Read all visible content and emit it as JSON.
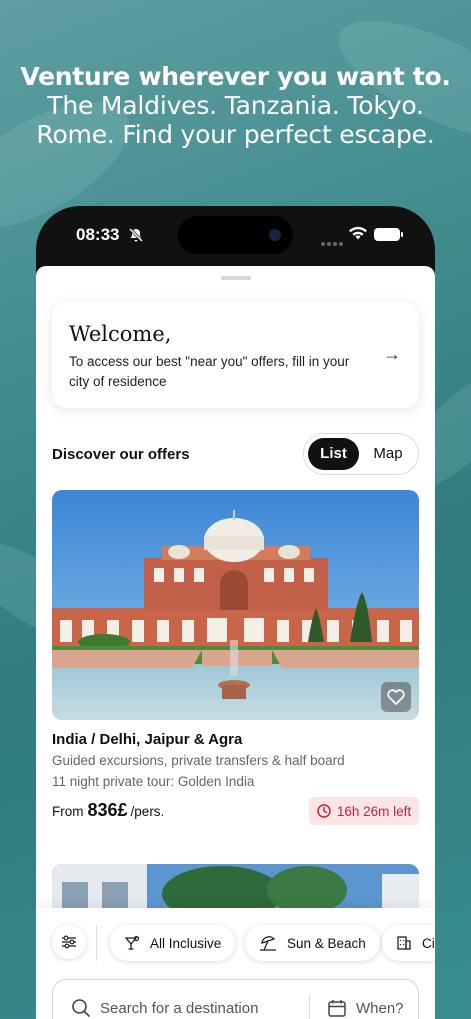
{
  "headline": {
    "line1": "Venture wherever you want to.",
    "line2": "The Maldives. Tanzania. Tokyo.",
    "line3": "Rome. Find your perfect escape."
  },
  "status_bar": {
    "time": "08:33"
  },
  "welcome": {
    "title": "Welcome,",
    "text": "To access our best \"near you\" offers, fill in your city of residence"
  },
  "offers": {
    "heading": "Discover our offers",
    "view_toggle": {
      "list": "List",
      "map": "Map",
      "selected": "List"
    }
  },
  "card": {
    "title": "India / Delhi, Jaipur & Agra",
    "subtitle1": "Guided excursions, private transfers & half board",
    "subtitle2": "11 night private tour: Golden India",
    "price_prefix": "From",
    "price": "836£",
    "price_suffix": "/pers.",
    "time_left": "16h 26m left"
  },
  "filters": {
    "chips": [
      "All Inclusive",
      "Sun & Beach",
      "Ci"
    ]
  },
  "search": {
    "placeholder": "Search for a destination",
    "when": "When?"
  },
  "colors": {
    "accent": "#111111",
    "timer_bg": "#fde4e6",
    "timer_text": "#c0263a"
  }
}
